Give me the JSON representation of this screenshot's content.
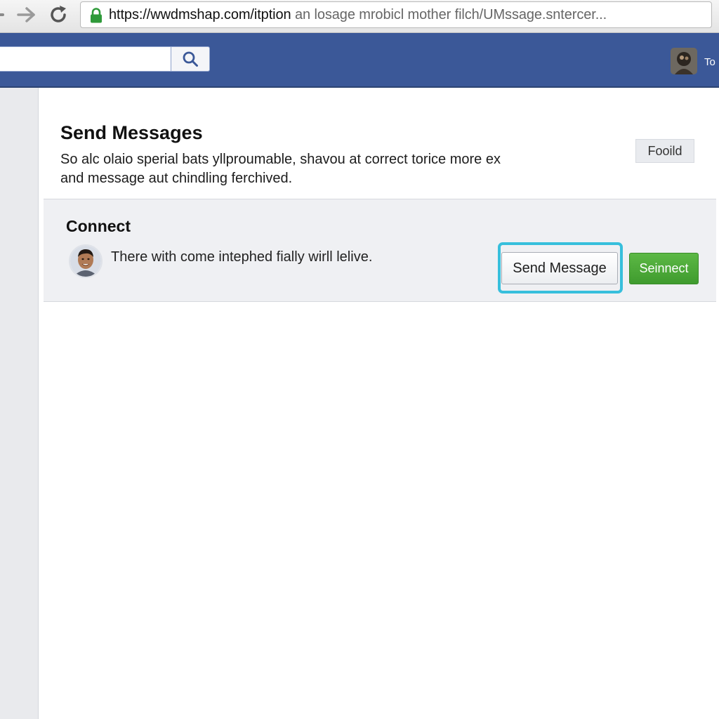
{
  "browser": {
    "url_host": "https://wwdmshap.com/itption",
    "url_rest": " an losage mrobicl mother filch/UMssage.sntercer...",
    "icons": {
      "back": "arrow-left-icon",
      "forward": "arrow-right-icon",
      "reload": "reload-icon",
      "lock": "lock-icon"
    }
  },
  "header": {
    "search_placeholder": "",
    "search_icon": "search-icon",
    "user_label": "To",
    "brand_color": "#3b5898"
  },
  "intro": {
    "title": "Send Messages",
    "description_line1": "So alc olaio sperial bats yllproumable, shavou at correct torice more ex",
    "description_line2": "and message aut chindling ferchived.",
    "badge": "Fooild"
  },
  "connect": {
    "title": "Connect",
    "text": "There with come intephed fially wirll lelive.",
    "send_message_label": "Send Message",
    "connect_label": "Seinnect",
    "highlight_color": "#37bfdc",
    "connect_color": "#4caf3a"
  }
}
